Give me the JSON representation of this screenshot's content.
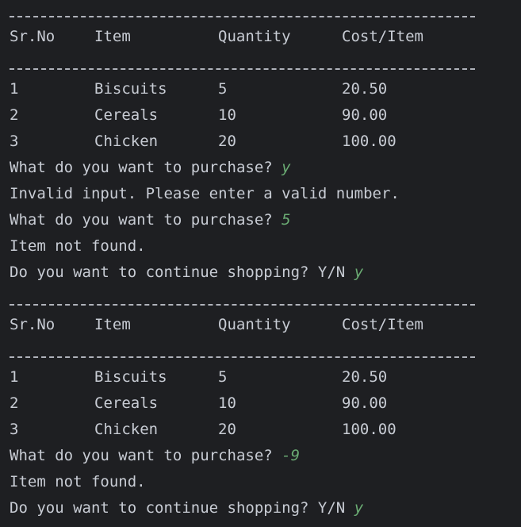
{
  "blocks": [
    {
      "header": [
        "Sr.No",
        "Item",
        "Quantity",
        "Cost/Item"
      ],
      "rows": [
        [
          "1",
          "Biscuits",
          "5",
          "20.50"
        ],
        [
          "2",
          "Cereals",
          "10",
          "90.00"
        ],
        [
          "3",
          "Chicken",
          "20",
          "100.00"
        ]
      ],
      "lines": [
        {
          "text": "What do you want to purchase? ",
          "input": "y"
        },
        {
          "text": "Invalid input. Please enter a valid number.",
          "input": ""
        },
        {
          "text": "What do you want to purchase? ",
          "input": "5"
        },
        {
          "text": "Item not found.",
          "input": ""
        },
        {
          "text": "Do you want to continue shopping? Y/N ",
          "input": "y"
        }
      ]
    },
    {
      "header": [
        "Sr.No",
        "Item",
        "Quantity",
        "Cost/Item"
      ],
      "rows": [
        [
          "1",
          "Biscuits",
          "5",
          "20.50"
        ],
        [
          "2",
          "Cereals",
          "10",
          "90.00"
        ],
        [
          "3",
          "Chicken",
          "20",
          "100.00"
        ]
      ],
      "lines": [
        {
          "text": "What do you want to purchase? ",
          "input": "-9"
        },
        {
          "text": "Item not found.",
          "input": ""
        },
        {
          "text": "Do you want to continue shopping? Y/N ",
          "input": "y"
        }
      ]
    }
  ],
  "colors": {
    "background": "#1e1f22",
    "text": "#c8ccd4",
    "user_input": "#6aab73"
  }
}
